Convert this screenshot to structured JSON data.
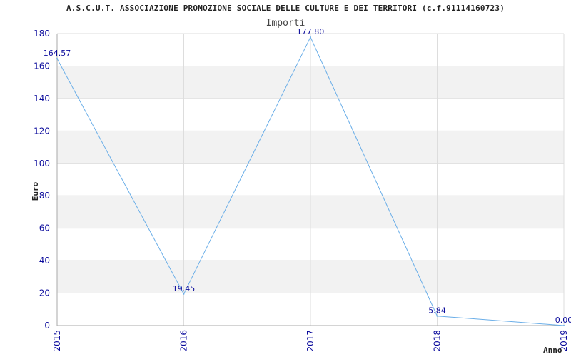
{
  "chart_data": {
    "type": "line",
    "title": "A.S.C.U.T. ASSOCIAZIONE PROMOZIONE SOCIALE DELLE CULTURE E DEI TERRITORI (c.f.91114160723)",
    "subtitle": "Importi",
    "xlabel": "Anno",
    "ylabel": "Euro",
    "categories": [
      "2015",
      "2016",
      "2017",
      "2018",
      "2019"
    ],
    "series": [
      {
        "values": [
          164.57,
          19.45,
          177.8,
          5.84,
          0.0
        ],
        "labels": [
          "164.57",
          "19.45",
          "177.80",
          "5.84",
          "0.00"
        ]
      }
    ],
    "ylim": [
      0,
      180
    ],
    "yticks": [
      0,
      20,
      40,
      60,
      80,
      100,
      120,
      140,
      160,
      180
    ],
    "grid": true,
    "colors": {
      "line": "#6aaee8",
      "band": "#f2f2f2",
      "tick_text": "#0a0a9c"
    }
  }
}
